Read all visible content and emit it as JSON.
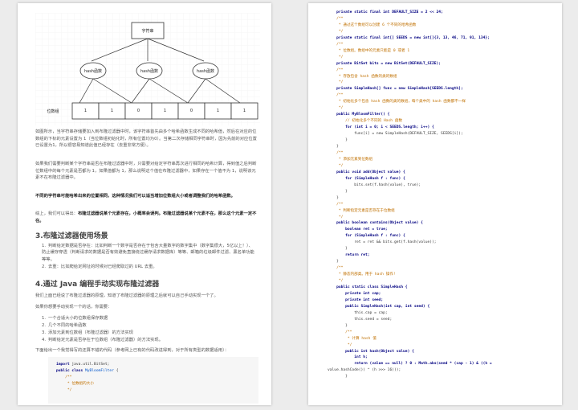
{
  "diagram": {
    "string_node": "字符串",
    "hash_labels": [
      "hash函数",
      "hash函数",
      "hash函数"
    ],
    "bit_array_label": "位数组",
    "bits": [
      "1",
      "1",
      "0",
      "1",
      "0",
      "1",
      "1"
    ]
  },
  "left_text": {
    "p1": "如图所示，当字符串存储要加入到布隆过滤器中时，该字符串首先由多个哈希函数生成不同的哈希值，然后在对应的位数组的下标的元素设置为 1（当位数组初始化时，所有位置均为0）。当第二次存储相同字符串时，因为先前的对应位置已设置为1，所以很容易知道此值已经存在（去重非常方便）。",
    "p2": "如果我们需要判断某个字符串是否在布隆过滤器中时，只需要对给定字符串再次进行相同的哈希计算，得到值之后判断位数组中的每个元素是否都为 1，如果值都为 1，那么说明这个值在布隆过滤器中，如果存在一个值不为 1，说明该元素不在布隆过滤器中。",
    "p3": "不同的字符串可能哈希出来的位置相同，这种情况我们可以适当增加位数组大小或者调整我们的哈希函数。",
    "p4a": "综上，我们可以得出：",
    "p4b": "布隆过滤器说某个元素存在，小概率会误判。布隆过滤器说某个元素不在，那么这个元素一定不在。",
    "h3": "3.布隆过滤器使用场景",
    "s3_items": [
      "判断给定数据是否存在：比如判断一个数字是否存在于包含大量数字的数字集中（数字集很大，5亿以上！）、防止缓存穿透（判断请求的数据是否有效避免直接绕过缓存请求数据库）等等、邮箱的垃圾邮件过滤、黑名单功能等等。",
      "去重：比如爬给定网址的时候对已经爬取过的 URL 去重。"
    ],
    "h4": "4.通过 Java 编程手动实现布隆过滤器",
    "p5": "我们上面已经说了布隆过滤器的原理，知道了布隆过滤器的原理之后就可以自己手动实现一个了。",
    "p6": "如果你想要手动实现一个的话，你需要：",
    "s4_items": [
      "一个合适大小的位数组保存数据",
      "几个不同的哈希函数",
      "添加元素到位数组（布隆过滤器）的方法实现",
      "判断给定元素是否存在于位数组（布隆过滤器）的方法实现。"
    ],
    "p7": "下面给出一个我觉得写的还算不错的代码（参考网上已有的代码改进得到，对于所有类型的数据适用）："
  },
  "left_code": [
    "import java.util.BitSet;",
    "public class MyBloomFilter {",
    "    /**",
    "     * 位数组的大小",
    "     */"
  ],
  "right_code": [
    "    private static final int DEFAULT_SIZE = 2 << 24;",
    "    /**",
    "     * 通过这个数组可以创建 6 个不同的哈希函数",
    "     */",
    "    private static final int[] SEEDS = new int[]{3, 13, 46, 71, 91, 134};",
    "    /**",
    "     * 位数组。数组中的元素只能是 0 或者 1",
    "     */",
    "    private BitSet bits = new BitSet(DEFAULT_SIZE);",
    "    /**",
    "     * 存放包含 hash 函数的类的数组",
    "     */",
    "    private SimpleHash[] func = new SimpleHash[SEEDS.length];",
    "    /**",
    "     * 初始化多个包含 hash 函数的类的数组，每个类中的 hash 函数都不一样",
    "     */",
    "    public MyBloomFilter() {",
    "        // 初始化多个不同的 Hash 函数",
    "        for (int i = 0; i < SEEDS.length; i++) {",
    "            func[i] = new SimpleHash(DEFAULT_SIZE, SEEDS[i]);",
    "        }",
    "    }",
    "    /**",
    "     * 添加元素到位数组",
    "     */",
    "    public void add(Object value) {",
    "        for (SimpleHash f : func) {",
    "            bits.set(f.hash(value), true);",
    "        }",
    "    }",
    "    /**",
    "     * 判断指定元素是否存在于位数组",
    "     */",
    "    public boolean contains(Object value) {",
    "        boolean ret = true;",
    "        for (SimpleHash f : func) {",
    "            ret = ret && bits.get(f.hash(value));",
    "        }",
    "        return ret;",
    "    }",
    "    /**",
    "     * 静态内部类。用于 hash 操作!",
    "     */",
    "    public static class SimpleHash {",
    "        private int cap;",
    "        private int seed;",
    "        public SimpleHash(int cap, int seed) {",
    "            this.cap = cap;",
    "            this.seed = seed;",
    "        }",
    "        /**",
    "         * 计算 hash 值",
    "         */",
    "        public int hash(Object value) {",
    "            int h;",
    "            return (value == null) ? 0 : Math.abs(seed * (cap - 1) & ((h =",
    "value.hashCode()) ^ (h >>> 16)));",
    "        }"
  ]
}
